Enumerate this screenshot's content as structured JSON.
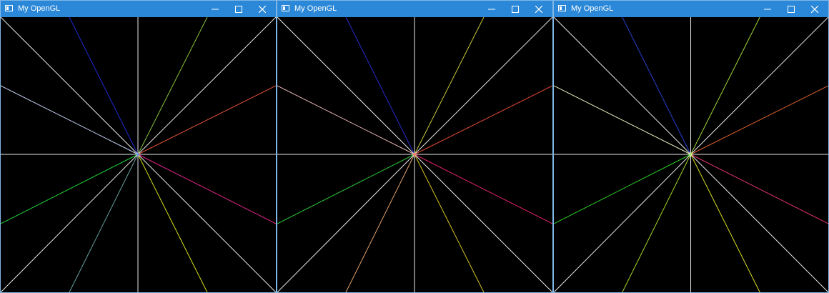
{
  "windows": [
    {
      "title": "My OpenGL",
      "controls": {
        "minimize": "minimize-icon",
        "maximize": "maximize-icon",
        "close": "close-icon"
      },
      "center_color": "#6b8fd8",
      "rays": [
        {
          "direction": "up-left-steep",
          "color": "#1f2bd0"
        },
        {
          "direction": "up-right-steep",
          "color": "#86c23a"
        },
        {
          "direction": "left-shallow-up",
          "color": "#c8d8f8"
        },
        {
          "direction": "right-shallow-up",
          "color": "#e6553a"
        },
        {
          "direction": "left-shallow-down",
          "color": "#22d63a"
        },
        {
          "direction": "right-shallow-down",
          "color": "#e2238c"
        },
        {
          "direction": "down-left-steep",
          "color": "#6aa2a0"
        },
        {
          "direction": "down-right-steep",
          "color": "#d8e01a"
        },
        {
          "direction": "diagonals",
          "color": "#e8e8e8"
        },
        {
          "direction": "axes",
          "color": "#e8e8e8"
        }
      ]
    },
    {
      "title": "My OpenGL",
      "controls": {
        "minimize": "minimize-icon",
        "maximize": "maximize-icon",
        "close": "close-icon"
      },
      "center_color": "#f07a62",
      "rays": [
        {
          "direction": "up-left-steep",
          "color": "#2a2bd0"
        },
        {
          "direction": "up-right-steep",
          "color": "#c9c83c"
        },
        {
          "direction": "left-shallow-up",
          "color": "#f0b8b8"
        },
        {
          "direction": "right-shallow-up",
          "color": "#e84a34"
        },
        {
          "direction": "left-shallow-down",
          "color": "#28cf34"
        },
        {
          "direction": "right-shallow-down",
          "color": "#e2246f"
        },
        {
          "direction": "down-left-steep",
          "color": "#e6a26a"
        },
        {
          "direction": "down-right-steep",
          "color": "#d6c61e"
        },
        {
          "direction": "diagonals",
          "color": "#e8e8e8"
        },
        {
          "direction": "axes",
          "color": "#e8e8e8"
        }
      ]
    },
    {
      "title": "My OpenGL",
      "controls": {
        "minimize": "minimize-icon",
        "maximize": "maximize-icon",
        "close": "close-icon"
      },
      "center_color": "#b8f06a",
      "rays": [
        {
          "direction": "up-left-steep",
          "color": "#2a3fd0"
        },
        {
          "direction": "up-right-steep",
          "color": "#9fd83a"
        },
        {
          "direction": "left-shallow-up",
          "color": "#e0f0b8"
        },
        {
          "direction": "right-shallow-up",
          "color": "#e0622e"
        },
        {
          "direction": "left-shallow-down",
          "color": "#2ed62a"
        },
        {
          "direction": "right-shallow-down",
          "color": "#e23472"
        },
        {
          "direction": "down-left-steep",
          "color": "#a8d82a"
        },
        {
          "direction": "down-right-steep",
          "color": "#d8e01a"
        },
        {
          "direction": "diagonals",
          "color": "#e8e8e8"
        },
        {
          "direction": "axes",
          "color": "#e8e8e8"
        }
      ]
    }
  ]
}
